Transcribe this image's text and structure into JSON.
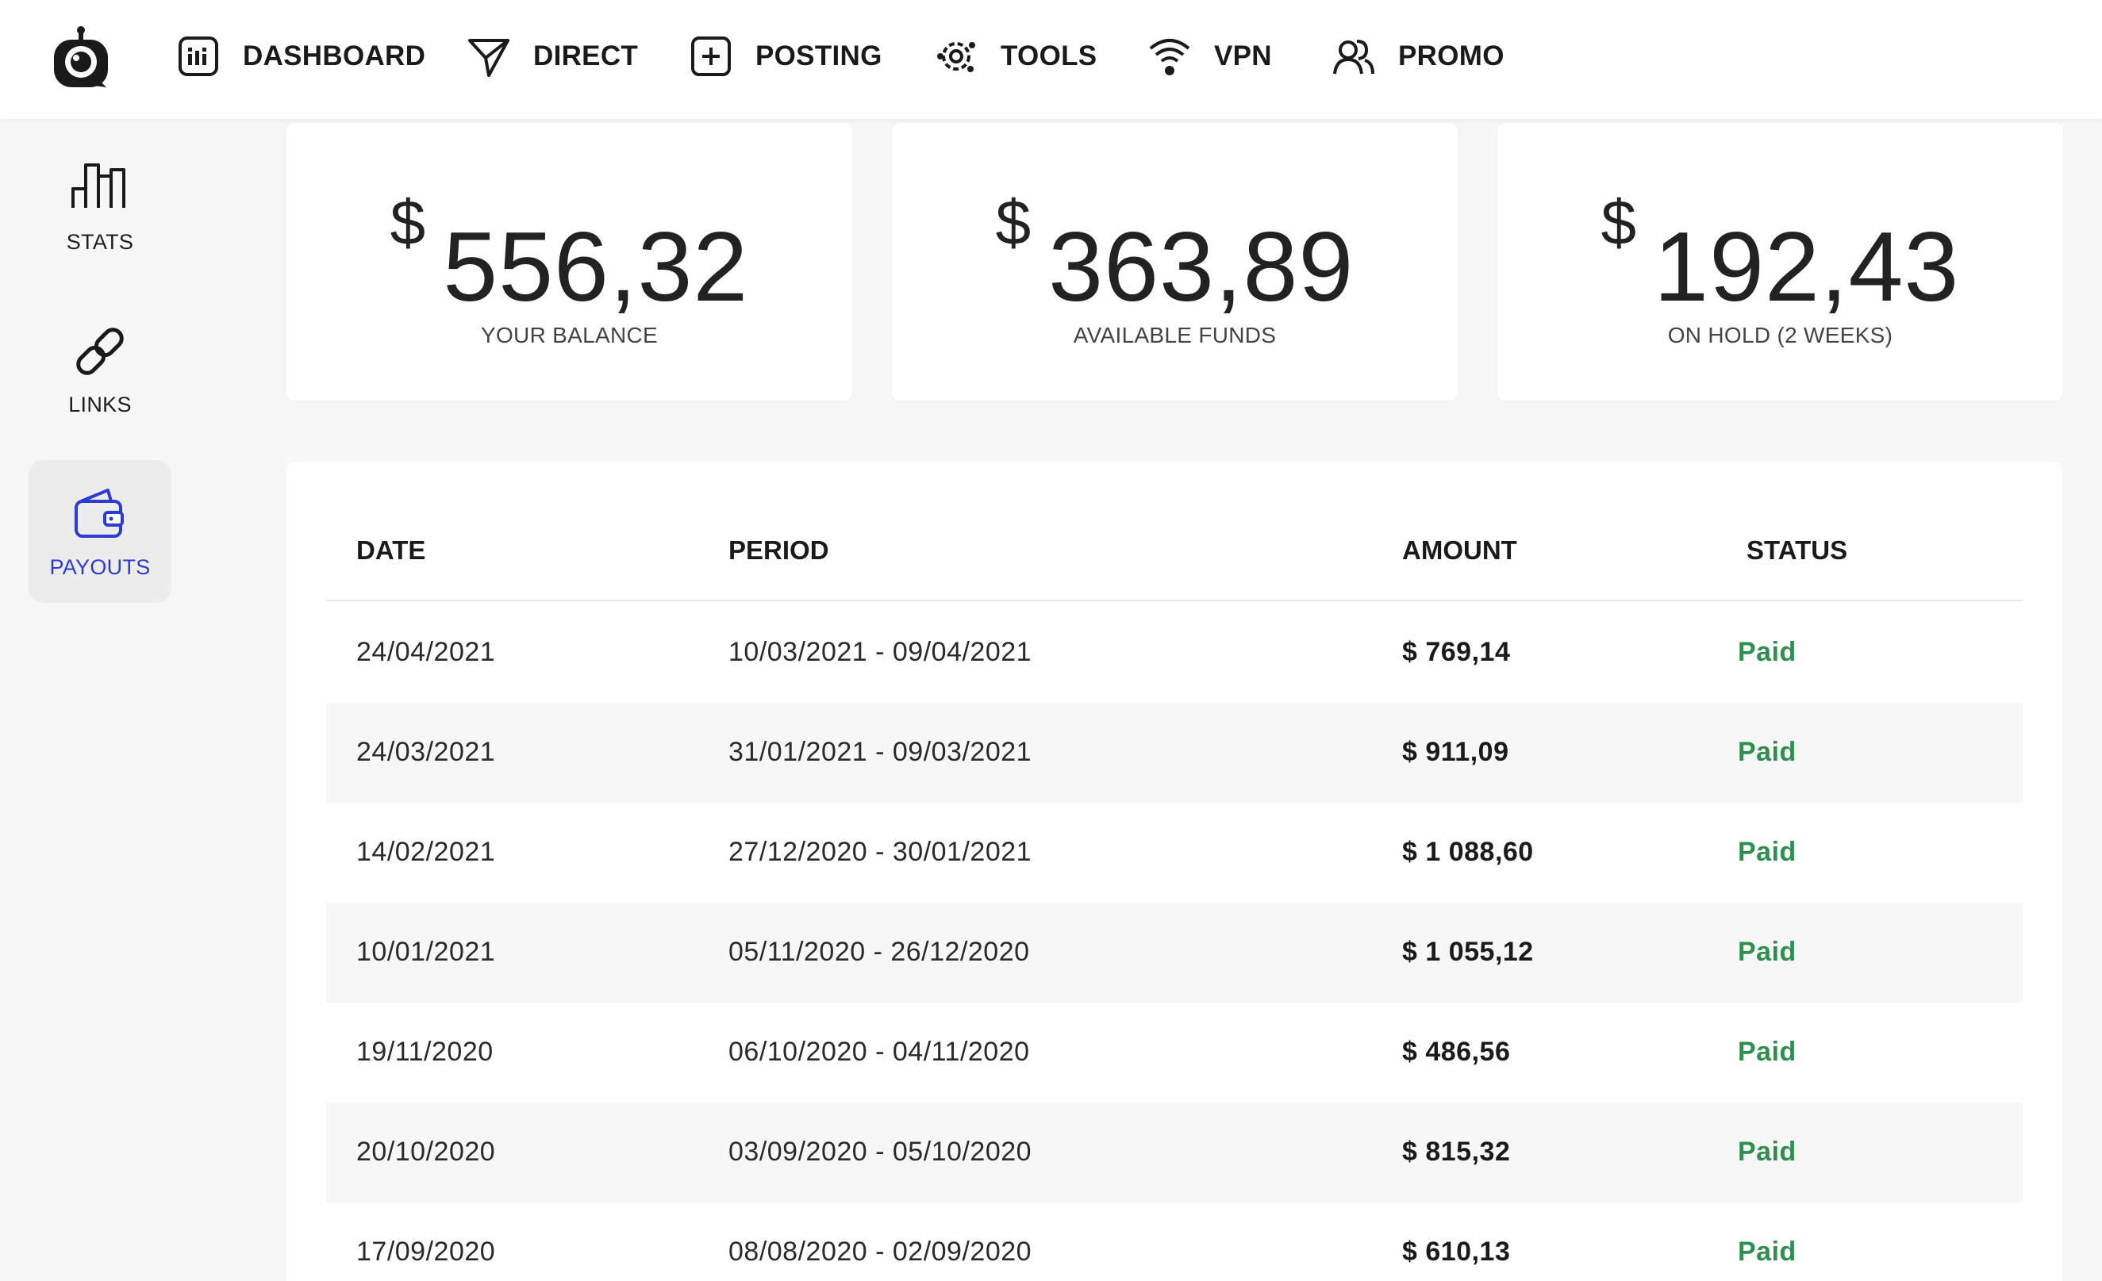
{
  "nav": {
    "items": [
      {
        "label": "DASHBOARD",
        "icon": "dashboard-icon"
      },
      {
        "label": "DIRECT",
        "icon": "send-icon"
      },
      {
        "label": "POSTING",
        "icon": "add-post-icon"
      },
      {
        "label": "TOOLS",
        "icon": "gear-icon"
      },
      {
        "label": "VPN",
        "icon": "wifi-icon"
      },
      {
        "label": "PROMO",
        "icon": "users-icon"
      }
    ]
  },
  "sidebar": {
    "items": [
      {
        "label": "STATS",
        "icon": "bar-chart-icon",
        "active": false
      },
      {
        "label": "LINKS",
        "icon": "link-icon",
        "active": false
      },
      {
        "label": "PAYOUTS",
        "icon": "wallet-icon",
        "active": true
      }
    ]
  },
  "stats": [
    {
      "currency": "$",
      "amount": "556,32",
      "caption": "YOUR BALANCE"
    },
    {
      "currency": "$",
      "amount": "363,89",
      "caption": "AVAILABLE FUNDS"
    },
    {
      "currency": "$",
      "amount": "192,43",
      "caption": "ON HOLD (2 WEEKS)"
    }
  ],
  "table": {
    "headers": {
      "date": "DATE",
      "period": "PERIOD",
      "amount": "AMOUNT",
      "status": "STATUS"
    },
    "rows": [
      {
        "date": "24/04/2021",
        "period": "10/03/2021 - 09/04/2021",
        "amount": "$ 769,14",
        "status": "Paid"
      },
      {
        "date": "24/03/2021",
        "period": "31/01/2021 - 09/03/2021",
        "amount": "$ 911,09",
        "status": "Paid"
      },
      {
        "date": "14/02/2021",
        "period": "27/12/2020 - 30/01/2021",
        "amount": "$ 1 088,60",
        "status": "Paid"
      },
      {
        "date": "10/01/2021",
        "period": "05/11/2020 - 26/12/2020",
        "amount": "$ 1 055,12",
        "status": "Paid"
      },
      {
        "date": "19/11/2020",
        "period": "06/10/2020 - 04/11/2020",
        "amount": "$ 486,56",
        "status": "Paid"
      },
      {
        "date": "20/10/2020",
        "period": "03/09/2020 - 05/10/2020",
        "amount": "$ 815,32",
        "status": "Paid"
      },
      {
        "date": "17/09/2020",
        "period": "08/08/2020 - 02/09/2020",
        "amount": "$ 610,13",
        "status": "Paid"
      }
    ]
  },
  "colors": {
    "active": "#2d3bd1",
    "paid": "#2f8f4e",
    "background": "#f7f7f7"
  }
}
